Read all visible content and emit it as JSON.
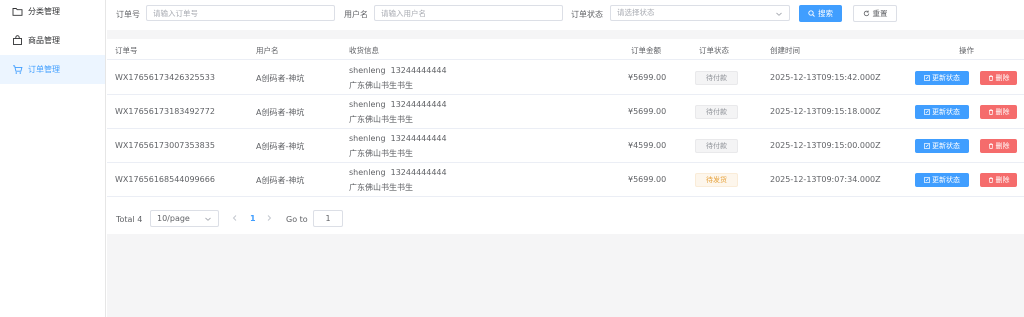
{
  "sidebar": {
    "items": [
      {
        "label": "分类管理",
        "icon": "folder-icon"
      },
      {
        "label": "商品管理",
        "icon": "bag-icon"
      },
      {
        "label": "订单管理",
        "icon": "cart-icon"
      }
    ]
  },
  "filter": {
    "order_no_label": "订单号",
    "order_no_placeholder": "请输入订单号",
    "username_label": "用户名",
    "username_placeholder": "请输入用户名",
    "status_label": "订单状态",
    "status_placeholder": "请选择状态",
    "search_label": "搜索",
    "reset_label": "重置"
  },
  "table": {
    "headers": {
      "order_no": "订单号",
      "username": "用户名",
      "shipping": "收货信息",
      "amount": "订单金额",
      "status": "订单状态",
      "created": "创建时间",
      "actions": "操作"
    },
    "rows": [
      {
        "order_no": "WX17656173426325533",
        "username": "A创码者-神坑",
        "name": "shenleng",
        "phone": "13244444444",
        "address": "广东佛山书生书生",
        "amount": "¥5699.00",
        "status": "待付款",
        "created": "2025-12-13T09:15:42.000Z"
      },
      {
        "order_no": "WX17656173183492772",
        "username": "A创码者-神坑",
        "name": "shenleng",
        "phone": "13244444444",
        "address": "广东佛山书生书生",
        "amount": "¥5699.00",
        "status": "待付款",
        "created": "2025-12-13T09:15:18.000Z"
      },
      {
        "order_no": "WX17656173007353835",
        "username": "A创码者-神坑",
        "name": "shenleng",
        "phone": "13244444444",
        "address": "广东佛山书生书生",
        "amount": "¥4599.00",
        "status": "待付款",
        "created": "2025-12-13T09:15:00.000Z"
      },
      {
        "order_no": "WX17656168544099666",
        "username": "A创码者-神坑",
        "name": "shenleng",
        "phone": "13244444444",
        "address": "广东佛山书生书生",
        "amount": "¥5699.00",
        "status": "待发货",
        "created": "2025-12-13T09:07:34.000Z"
      }
    ],
    "update_label": "更新状态",
    "delete_label": "删除"
  },
  "pagination": {
    "total": "Total 4",
    "page_size": "10/page",
    "current_page": "1",
    "goto_label": "Go to",
    "goto_value": "1"
  },
  "colors": {
    "primary": "#409eff",
    "danger": "#f56c6c",
    "warning": "#e6a23c"
  }
}
